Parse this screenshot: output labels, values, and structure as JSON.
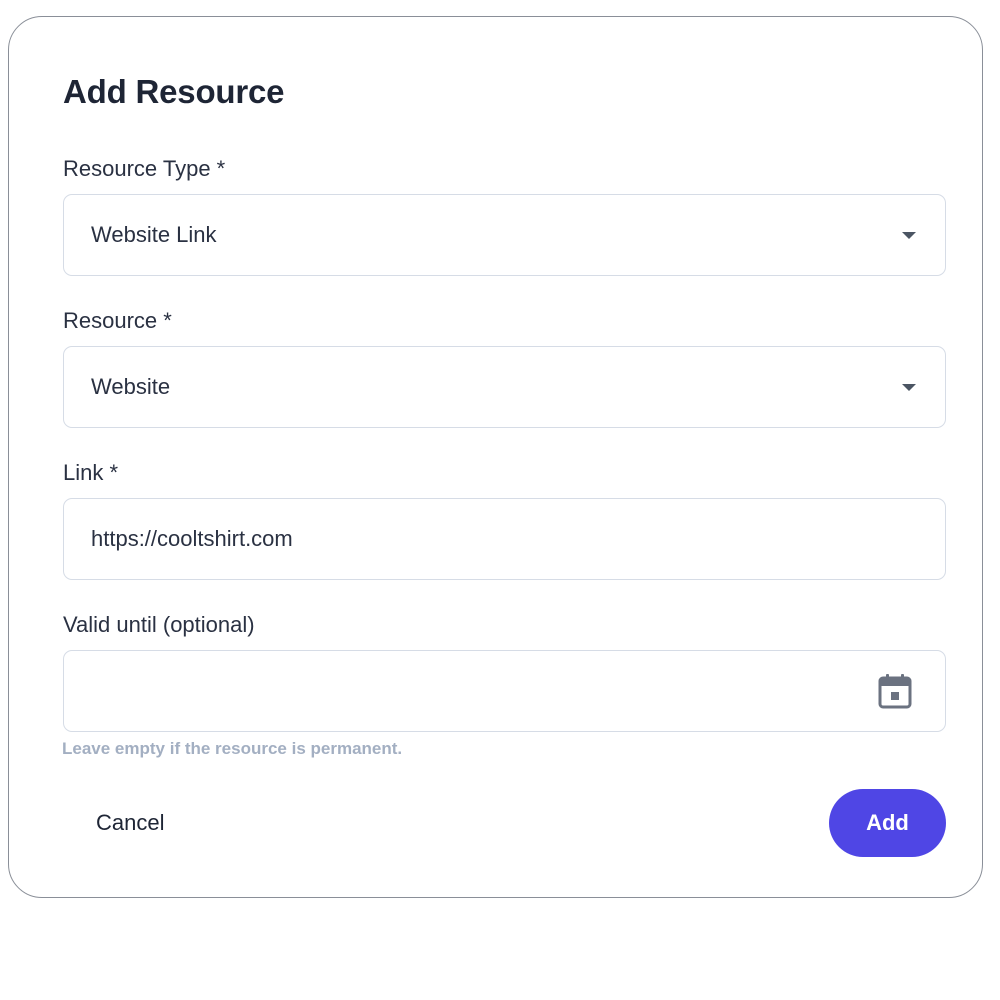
{
  "dialog": {
    "title": "Add Resource"
  },
  "fields": {
    "resource_type": {
      "label": "Resource Type *",
      "value": "Website Link",
      "icon": "chevron-down-icon"
    },
    "resource": {
      "label": "Resource *",
      "value": "Website",
      "icon": "chevron-down-icon"
    },
    "link": {
      "label": "Link *",
      "value": "https://cooltshirt.com"
    },
    "valid_until": {
      "label": "Valid until (optional)",
      "value": "",
      "icon": "calendar-icon",
      "helper": "Leave empty if the resource is permanent."
    }
  },
  "actions": {
    "cancel_label": "Cancel",
    "add_label": "Add"
  },
  "colors": {
    "primary": "#4f46e5",
    "border": "#d6dce6",
    "helper_text": "#a3afc2",
    "icon": "#4b5563"
  }
}
